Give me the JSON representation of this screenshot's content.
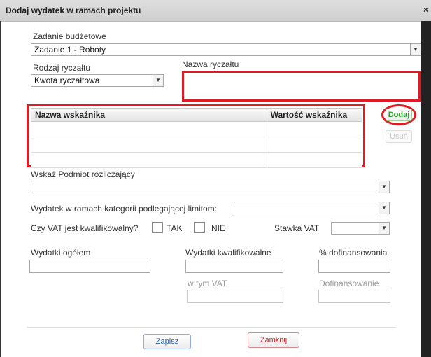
{
  "window": {
    "title": "Dodaj wydatek w ramach projektu",
    "close_label": "×"
  },
  "budget_task": {
    "label": "Zadanie budżetowe",
    "value": "Zadanie 1 - Roboty"
  },
  "lump_type": {
    "label": "Rodzaj ryczałtu",
    "value": "Kwota ryczałtowa"
  },
  "lump_name": {
    "label": "Nazwa ryczałtu",
    "value": ""
  },
  "indicators": {
    "columns": [
      "Nazwa wskaźnika",
      "Wartość wskaźnika"
    ],
    "rows": [
      [
        "",
        ""
      ],
      [
        "",
        ""
      ],
      [
        "",
        ""
      ]
    ],
    "add_label": "Dodaj",
    "remove_label": "Usuń"
  },
  "settling_entity": {
    "label": "Wskaż Podmiot rozliczający",
    "value": ""
  },
  "limit_category": {
    "label": "Wydatek w ramach kategorii podlegającej limitom:",
    "value": ""
  },
  "vat": {
    "question": "Czy VAT jest kwalifikowalny?",
    "yes_label": "TAK",
    "no_label": "NIE",
    "rate_label": "Stawka VAT",
    "rate_value": ""
  },
  "amounts": {
    "total_label": "Wydatki ogółem",
    "eligible_label": "Wydatki kwalifikowalne",
    "cofinancing_pct_label": "% dofinansowania",
    "vat_included_label": "w tym VAT",
    "cofinancing_label": "Dofinansowanie"
  },
  "footer": {
    "save_label": "Zapisz",
    "close_label": "Zamknij"
  },
  "colors": {
    "highlight": "#e01b24",
    "add_text": "#2a9d2a",
    "save_text": "#2f5fa8",
    "close_text": "#c0262d"
  }
}
